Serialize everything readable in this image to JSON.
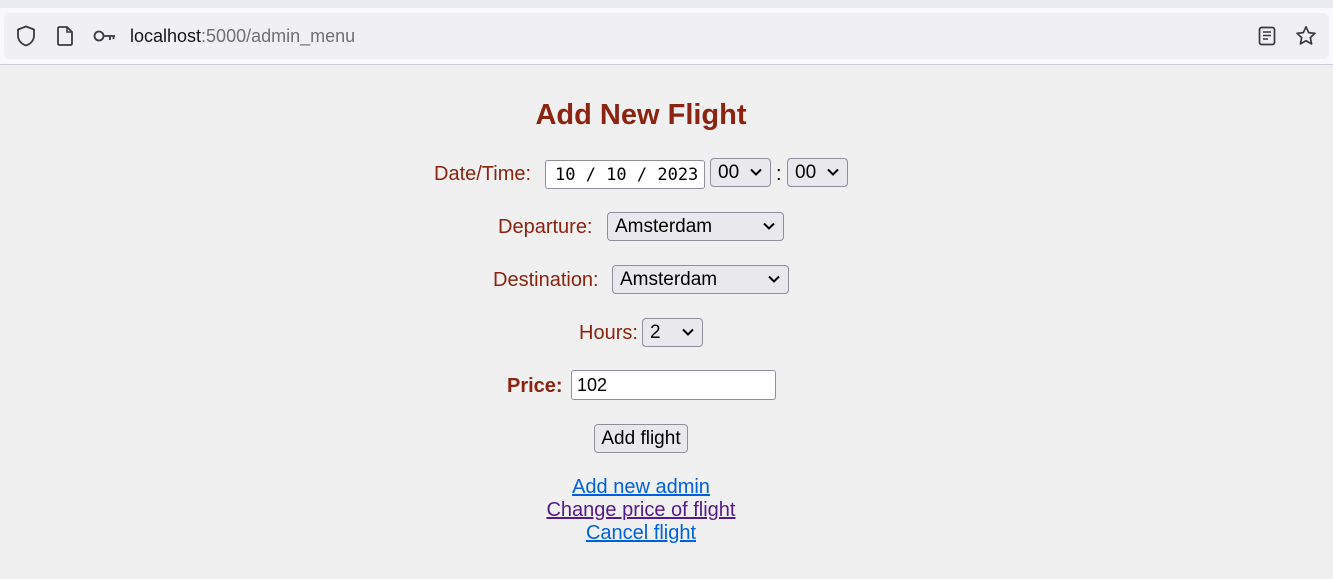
{
  "browser": {
    "url_host": "localhost",
    "url_path": ":5000/admin_menu",
    "icons": [
      "shield-icon",
      "page-icon",
      "key-icon",
      "reader-view-icon",
      "bookmark-star-icon"
    ]
  },
  "form": {
    "title": "Add New Flight",
    "datetime_label": "Date/Time:",
    "date_value": "10 / 10 / 2023",
    "hour_value": "00",
    "time_separator": ":",
    "minute_value": "00",
    "departure_label": "Departure:",
    "departure_value": "Amsterdam",
    "destination_label": "Destination:",
    "destination_value": "Amsterdam",
    "hours_label": "Hours:",
    "hours_value": "2",
    "price_label": "Price:",
    "price_value": "102",
    "submit_label": "Add flight"
  },
  "links": {
    "add_admin": "Add new admin",
    "change_price": "Change price of flight",
    "cancel_flight": "Cancel flight"
  },
  "colors": {
    "label": "#8b2411",
    "link": "#0060df",
    "visited_link": "#551a8b"
  }
}
